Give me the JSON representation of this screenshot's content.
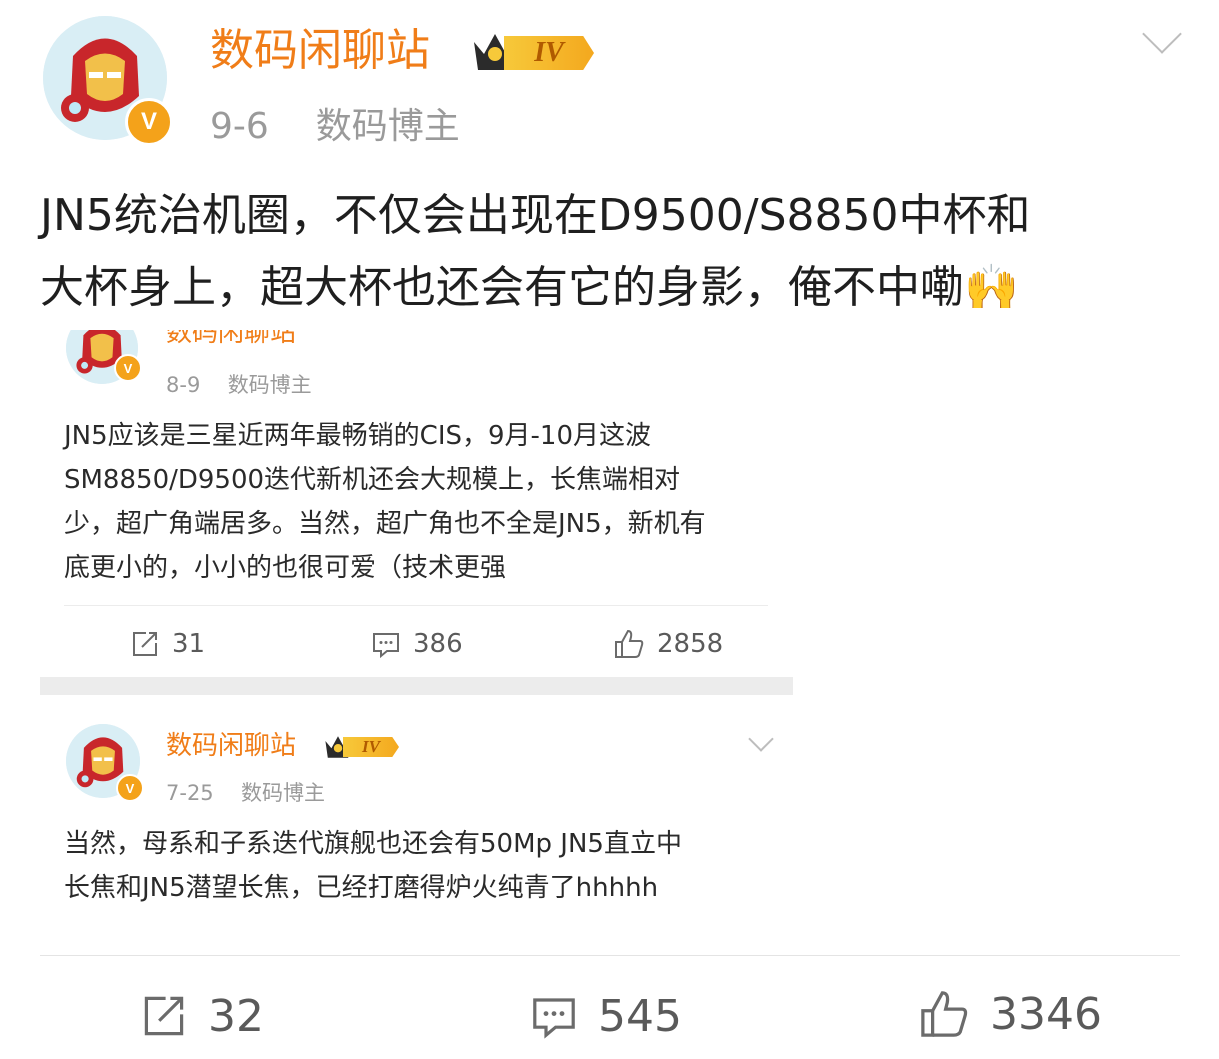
{
  "post": {
    "username": "数码闲聊站",
    "level": "IV",
    "date": "9-6",
    "role": "数码博主",
    "text_line1": "JN5统治机圈，不仅会出现在D9500/S8850中杯和",
    "text_line2": "大杯身上，超大杯也还会有它的身影，俺不中嘞🙌",
    "repost_count": "32",
    "comment_count": "545",
    "like_count": "3346"
  },
  "quoted1": {
    "username": "数码闲聊站",
    "date": "8-9",
    "role": "数码博主",
    "lines": [
      "JN5应该是三星近两年最畅销的CIS，9月-10月这波",
      "SM8850/D9500迭代新机还会大规模上，长焦端相对",
      "少，超广角端居多。当然，超广角也不全是JN5，新机有",
      "底更小的，小小的也很可爱（技术更强"
    ],
    "repost_count": "31",
    "comment_count": "386",
    "like_count": "2858"
  },
  "quoted2": {
    "username": "数码闲聊站",
    "level": "IV",
    "date": "7-25",
    "role": "数码博主",
    "lines": [
      "当然，母系和子系迭代旗舰也还会有50Mp JN5直立中",
      "长焦和JN5潜望长焦，已经打磨得炉火纯青了hhhhh"
    ]
  },
  "icons": [
    "repost-icon",
    "comment-icon",
    "like-icon",
    "chevron-down-icon",
    "verified-icon",
    "crown-icon"
  ],
  "colors": {
    "username": "#f07d18",
    "verified": "#f4a21a",
    "meta": "#9a9a9a"
  }
}
